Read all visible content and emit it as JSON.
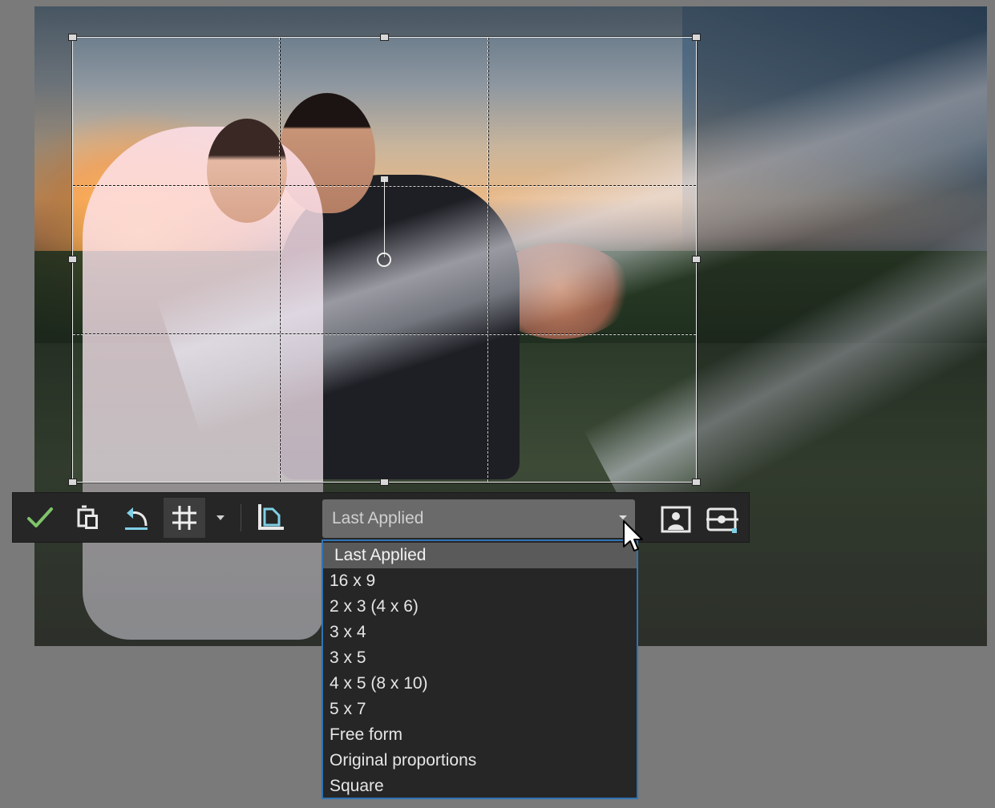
{
  "toolbar": {
    "apply_icon": "checkmark-icon",
    "crop_mode_icon": "crop-rotate-icon",
    "undo_icon": "undo-arrow-icon",
    "grid_icon": "grid-icon",
    "grid_options_icon": "chevron-down-icon",
    "orientation_icon": "orientation-swap-icon",
    "portrait_icon": "portrait-icon",
    "straighten_icon": "straighten-icon"
  },
  "aspect_dropdown": {
    "selected": "Last Applied",
    "options": [
      "Last Applied",
      "16 x 9",
      "2 x 3 (4 x 6)",
      "3 x 4",
      "3 x 5",
      "4 x 5 (8 x 10)",
      "5 x 7",
      "Free form",
      "Original proportions",
      "Square"
    ]
  },
  "colors": {
    "toolbar_bg": "#262626",
    "dropdown_bg": "#6a6a6a",
    "menu_border": "#2f74b5",
    "apply_check": "#7ec46a",
    "accent_icon": "#7fd0e6"
  }
}
